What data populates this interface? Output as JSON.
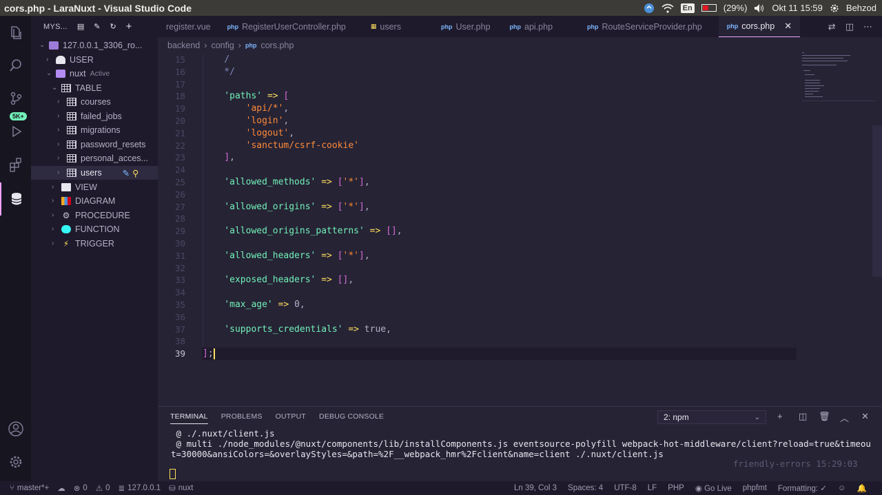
{
  "window_title": "cors.php - LaraNuxt - Visual Studio Code",
  "tray": {
    "language": "En",
    "battery": "(29%)",
    "datetime": "Okt 11 15:59",
    "user": "Behzod"
  },
  "activity_bar": {
    "extensions_badge": "5K+"
  },
  "sidebar": {
    "header": "MYS...",
    "connection": "127.0.0.1_3306_ro...",
    "items": [
      {
        "label": "USER",
        "level": 1
      },
      {
        "label": "nuxt",
        "level": 1,
        "note": "Active"
      },
      {
        "label": "TABLE",
        "level": 2
      },
      {
        "label": "courses",
        "level": 3
      },
      {
        "label": "failed_jobs",
        "level": 3
      },
      {
        "label": "migrations",
        "level": 3
      },
      {
        "label": "password_resets",
        "level": 3
      },
      {
        "label": "personal_acces...",
        "level": 3
      },
      {
        "label": "users",
        "level": 3
      },
      {
        "label": "VIEW",
        "level": 2
      },
      {
        "label": "DIAGRAM",
        "level": 2
      },
      {
        "label": "PROCEDURE",
        "level": 2
      },
      {
        "label": "FUNCTION",
        "level": 2
      },
      {
        "label": "TRIGGER",
        "level": 2
      }
    ]
  },
  "tabs": [
    {
      "label": "register.vue",
      "icon": ""
    },
    {
      "label": "RegisterUserController.php",
      "icon": "php"
    },
    {
      "label": "users",
      "icon": "table"
    },
    {
      "label": "User.php",
      "icon": "php"
    },
    {
      "label": "api.php",
      "icon": "php"
    },
    {
      "label": "RouteServiceProvider.php",
      "icon": "php"
    },
    {
      "label": "cors.php",
      "icon": "php",
      "active": true
    }
  ],
  "breadcrumb": [
    "backend",
    "config",
    "cors.php"
  ],
  "code": [
    {
      "n": "15",
      "text": "    /"
    },
    {
      "n": "16",
      "text": "    */"
    },
    {
      "n": "17",
      "text": ""
    },
    {
      "n": "18",
      "text": "    'paths' => ["
    },
    {
      "n": "19",
      "text": "        'api/*',"
    },
    {
      "n": "20",
      "text": "        'login',"
    },
    {
      "n": "21",
      "text": "        'logout',"
    },
    {
      "n": "22",
      "text": "        'sanctum/csrf-cookie'"
    },
    {
      "n": "23",
      "text": "    ],"
    },
    {
      "n": "24",
      "text": ""
    },
    {
      "n": "25",
      "text": "    'allowed_methods' => ['*'],"
    },
    {
      "n": "26",
      "text": ""
    },
    {
      "n": "27",
      "text": "    'allowed_origins' => ['*'],"
    },
    {
      "n": "28",
      "text": ""
    },
    {
      "n": "29",
      "text": "    'allowed_origins_patterns' => [],"
    },
    {
      "n": "30",
      "text": ""
    },
    {
      "n": "31",
      "text": "    'allowed_headers' => ['*'],"
    },
    {
      "n": "32",
      "text": ""
    },
    {
      "n": "33",
      "text": "    'exposed_headers' => [],"
    },
    {
      "n": "34",
      "text": ""
    },
    {
      "n": "35",
      "text": "    'max_age' => 0,"
    },
    {
      "n": "36",
      "text": ""
    },
    {
      "n": "37",
      "text": "    'supports_credentials' => true,"
    },
    {
      "n": "38",
      "text": ""
    },
    {
      "n": "39",
      "text": "];"
    }
  ],
  "panel": {
    "tabs": [
      "TERMINAL",
      "PROBLEMS",
      "OUTPUT",
      "DEBUG CONSOLE"
    ],
    "terminal_select": "2: npm",
    "lines": [
      " @ ./.nuxt/client.js",
      " @ multi ./node_modules/@nuxt/components/lib/installComponents.js eventsource-polyfill webpack-hot-middleware/client?reload=true&timeou",
      "t=30000&ansiColors=&overlayStyles=&path=%2F__webpack_hmr%2Fclient&name=client ./.nuxt/client.js"
    ],
    "timestamp": "friendly-errors 15:29:03"
  },
  "status": {
    "branch": "master*+",
    "errors": "0",
    "warnings": "0",
    "host": "127.0.0.1",
    "db": "nuxt",
    "position": "Ln 39, Col 3",
    "spaces": "Spaces: 4",
    "encoding": "UTF-8",
    "eol": "LF",
    "language": "PHP",
    "golive": "Go Live",
    "formatter": "phpfmt",
    "formatting": "Formatting:"
  }
}
